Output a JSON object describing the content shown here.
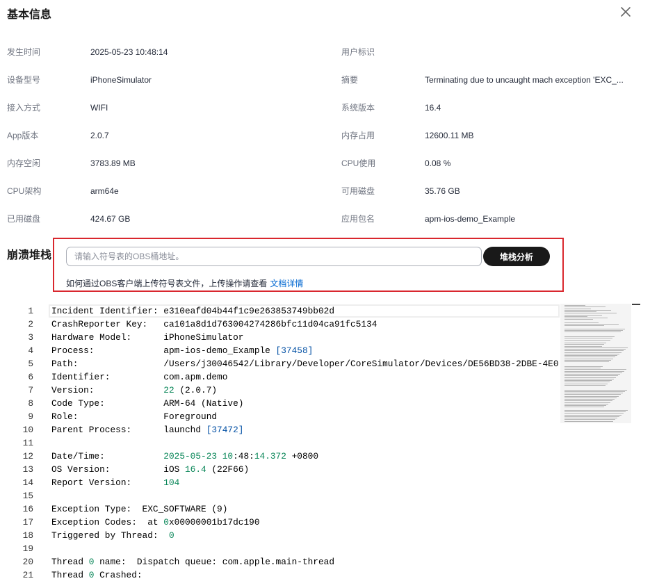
{
  "dialog": {
    "title": "基本信息",
    "close_icon": "close-icon"
  },
  "basic_info": {
    "left": [
      {
        "label": "发生时间",
        "value": "2025-05-23 10:48:14"
      },
      {
        "label": "设备型号",
        "value": "iPhoneSimulator"
      },
      {
        "label": "接入方式",
        "value": "WIFI"
      },
      {
        "label": "App版本",
        "value": "2.0.7"
      },
      {
        "label": "内存空闲",
        "value": "3783.89 MB"
      },
      {
        "label": "CPU架构",
        "value": "arm64e"
      },
      {
        "label": "已用磁盘",
        "value": "424.67 GB"
      }
    ],
    "right": [
      {
        "label": "用户标识",
        "value": ""
      },
      {
        "label": "摘要",
        "value": "Terminating due to uncaught mach exception 'EXC_..."
      },
      {
        "label": "系统版本",
        "value": "16.4"
      },
      {
        "label": "内存占用",
        "value": "12600.11 MB"
      },
      {
        "label": "CPU使用",
        "value": "0.08 %"
      },
      {
        "label": "可用磁盘",
        "value": "35.76 GB"
      },
      {
        "label": "应用包名",
        "value": "apm-ios-demo_Example"
      }
    ]
  },
  "crash_stack": {
    "title": "崩溃堆栈",
    "obs_input": {
      "placeholder": "请输入符号表的OBS桶地址。",
      "value": ""
    },
    "analyze_button": "堆栈分析",
    "help_text": "如何通过OBS客户端上传符号表文件，上传操作请查看",
    "help_link": "文档详情"
  },
  "code": {
    "lines": [
      {
        "n": "1",
        "tokens": [
          {
            "text": "Incident Identifier: e310eafd04b44f1c9e263853749bb02d"
          }
        ]
      },
      {
        "n": "2",
        "tokens": [
          {
            "text": "CrashReporter Key:   ca101a8d1d763004274286bfc11d04ca91fc5134"
          }
        ]
      },
      {
        "n": "3",
        "tokens": [
          {
            "text": "Hardware Model:      iPhoneSimulator"
          }
        ]
      },
      {
        "n": "4",
        "tokens": [
          {
            "text": "Process:             apm-ios-demo_Example "
          },
          {
            "ref": "[37458]"
          }
        ]
      },
      {
        "n": "5",
        "tokens": [
          {
            "text": "Path:                /Users/j30046542/Library/Developer/CoreSimulator/Devices/DE56BD38-2DBE-4E0"
          }
        ]
      },
      {
        "n": "6",
        "tokens": [
          {
            "text": "Identifier:          com.apm.demo"
          }
        ]
      },
      {
        "n": "7",
        "tokens": [
          {
            "text": "Version:             "
          },
          {
            "number": "22"
          },
          {
            "text": " (2.0.7)"
          }
        ]
      },
      {
        "n": "8",
        "tokens": [
          {
            "text": "Code Type:           ARM-64 (Native)"
          }
        ]
      },
      {
        "n": "9",
        "tokens": [
          {
            "text": "Role:                Foreground"
          }
        ]
      },
      {
        "n": "10",
        "tokens": [
          {
            "text": "Parent Process:      launchd "
          },
          {
            "ref": "[37472]"
          }
        ]
      },
      {
        "n": "11",
        "tokens": []
      },
      {
        "n": "12",
        "tokens": [
          {
            "text": "Date/Time:           "
          },
          {
            "number": "2025-05-23 10"
          },
          {
            "text": ":48:"
          },
          {
            "number": "14.372"
          },
          {
            "text": " +0800"
          }
        ]
      },
      {
        "n": "13",
        "tokens": [
          {
            "text": "OS Version:          iOS "
          },
          {
            "number": "16.4"
          },
          {
            "text": " (22F66)"
          }
        ]
      },
      {
        "n": "14",
        "tokens": [
          {
            "text": "Report Version:      "
          },
          {
            "number": "104"
          }
        ]
      },
      {
        "n": "15",
        "tokens": []
      },
      {
        "n": "16",
        "tokens": [
          {
            "text": "Exception Type:  EXC_SOFTWARE (9)"
          }
        ]
      },
      {
        "n": "17",
        "tokens": [
          {
            "text": "Exception Codes:  at "
          },
          {
            "number": "0"
          },
          {
            "text": "x00000001b17dc190"
          }
        ]
      },
      {
        "n": "18",
        "tokens": [
          {
            "text": "Triggered by Thread:  "
          },
          {
            "number": "0"
          }
        ]
      },
      {
        "n": "19",
        "tokens": []
      },
      {
        "n": "20",
        "tokens": [
          {
            "text": "Thread "
          },
          {
            "number": "0"
          },
          {
            "text": " name:  Dispatch queue: com.apple.main-thread"
          }
        ]
      },
      {
        "n": "21",
        "tokens": [
          {
            "text": "Thread "
          },
          {
            "number": "0"
          },
          {
            "text": " Crashed:"
          }
        ]
      }
    ]
  },
  "colors": {
    "number": "#098658",
    "reference": "#0451a5",
    "link": "#0067d1",
    "button_bg": "#191919",
    "annotation_red": "#d9272e"
  }
}
